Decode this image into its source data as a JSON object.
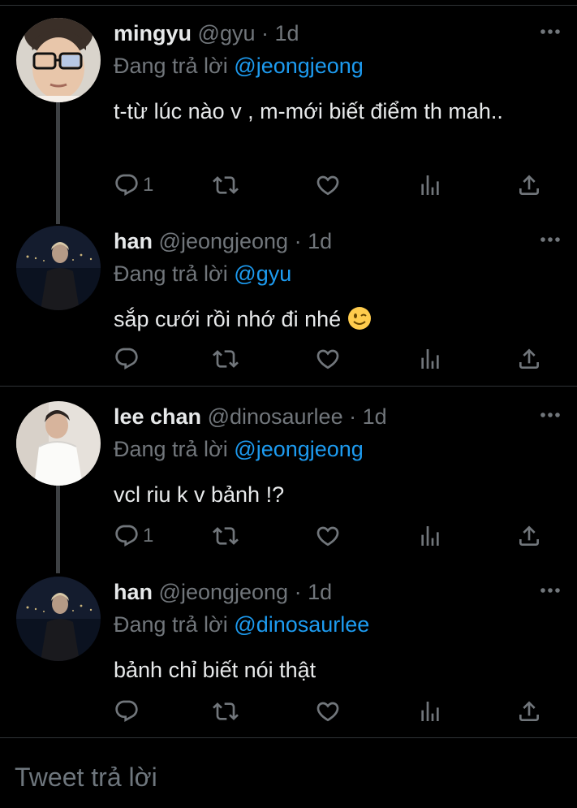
{
  "tweets": [
    {
      "name": "mingyu",
      "handle": "@gyu",
      "dot": "·",
      "time": "1d",
      "reply_prefix": "Đang trả lời",
      "reply_to": "@jeongjeong",
      "text": "t-từ lúc nào v , m-mới biết điểm th mah..",
      "reply_count": "1",
      "avatar": "mingyu-avatar"
    },
    {
      "name": "han",
      "handle": "@jeongjeong",
      "dot": "·",
      "time": "1d",
      "reply_prefix": "Đang trả lời",
      "reply_to": "@gyu",
      "text": "sắp cưới rồi nhớ đi nhé",
      "emoji": "winking-face-emoji",
      "reply_count": "",
      "avatar": "han-avatar"
    },
    {
      "name": "lee chan",
      "handle": "@dinosaurlee",
      "dot": "·",
      "time": "1d",
      "reply_prefix": "Đang trả lời",
      "reply_to": "@jeongjeong",
      "text": "vcl riu k v bảnh !?",
      "reply_count": "1",
      "avatar": "lee-chan-avatar"
    },
    {
      "name": "han",
      "handle": "@jeongjeong",
      "dot": "·",
      "time": "1d",
      "reply_prefix": "Đang trả lời",
      "reply_to": "@dinosaurlee",
      "text": "bảnh chỉ biết nói thật",
      "reply_count": "",
      "avatar": "han-avatar"
    }
  ],
  "icons": {
    "reply": "reply-icon",
    "retweet": "retweet-icon",
    "like": "like-icon",
    "views": "views-icon",
    "share": "share-icon",
    "more": "more-icon"
  },
  "colors": {
    "background": "#000000",
    "text": "#e7e9ea",
    "secondary": "#71767b",
    "link": "#1d9bf0",
    "thread_line": "#3e4144"
  },
  "compose": {
    "placeholder": "Tweet trả lời"
  }
}
